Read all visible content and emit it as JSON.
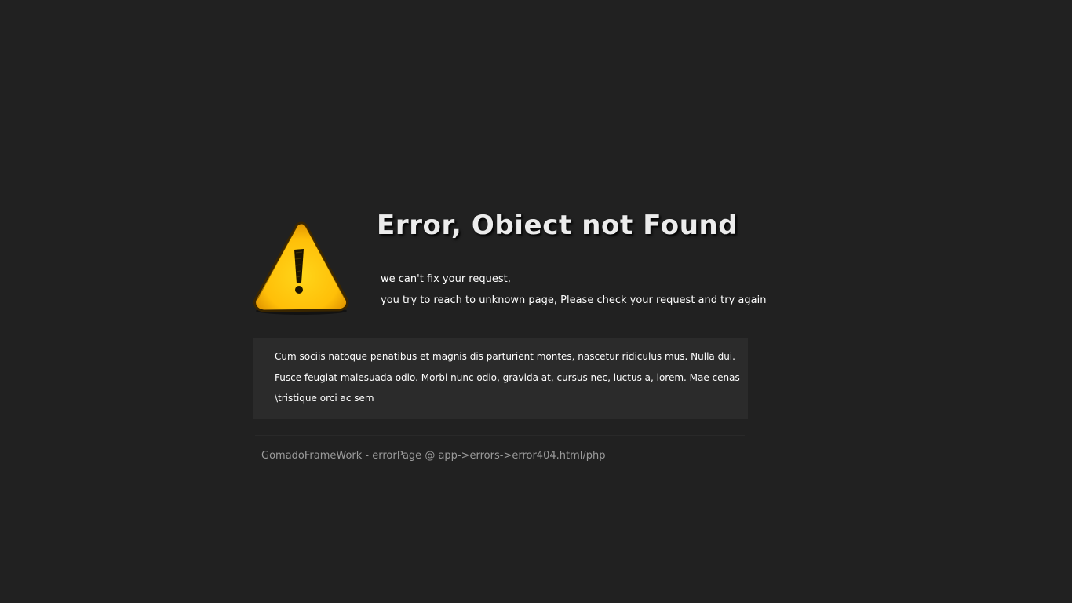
{
  "error": {
    "title": "Error, Obiect not Found",
    "message_lines": [
      "we can't fix your request,",
      "you try to reach to unknown page, Please check your request and try again"
    ],
    "icon": "warning-icon"
  },
  "info_box": {
    "lines": [
      "Cum sociis natoque penatibus et magnis dis parturient montes, nascetur ridiculus mus. Nulla dui.",
      "Fusce feugiat malesuada odio. Morbi nunc odio, gravida at, cursus nec, luctus a, lorem. Mae cenas",
      "\\tristique orci ac sem"
    ]
  },
  "footer": {
    "text": "GomadoFrameWork - errorPage @ app->errors->error404.html/php"
  },
  "colors": {
    "background": "#212121",
    "info_box_background": "#2b2b2b",
    "warning_yellow": "#ffc40a",
    "footer_text": "#9b9b9b"
  }
}
